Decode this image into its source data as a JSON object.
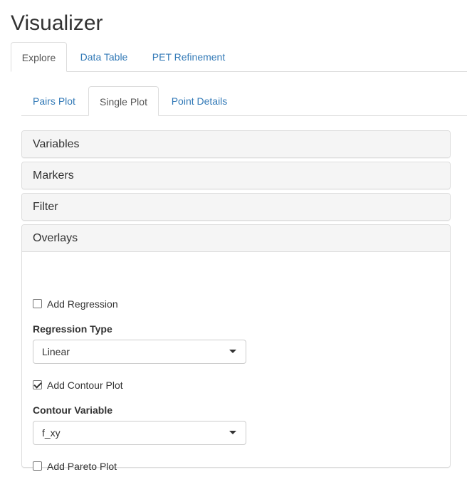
{
  "app": {
    "title": "Visualizer"
  },
  "top_tabs": [
    {
      "label": "Explore",
      "active": true
    },
    {
      "label": "Data Table",
      "active": false
    },
    {
      "label": "PET Refinement",
      "active": false
    }
  ],
  "sub_tabs": [
    {
      "label": "Pairs Plot",
      "active": false
    },
    {
      "label": "Single Plot",
      "active": true
    },
    {
      "label": "Point Details",
      "active": false
    }
  ],
  "panels": {
    "variables": {
      "title": "Variables",
      "expanded": false
    },
    "markers": {
      "title": "Markers",
      "expanded": false
    },
    "filter": {
      "title": "Filter",
      "expanded": false
    },
    "overlays": {
      "title": "Overlays",
      "expanded": true,
      "add_regression": {
        "label": "Add Regression",
        "checked": false
      },
      "regression_type": {
        "label": "Regression Type",
        "value": "Linear"
      },
      "add_contour": {
        "label": "Add Contour Plot",
        "checked": true
      },
      "contour_variable": {
        "label": "Contour Variable",
        "value": "f_xy"
      },
      "add_pareto": {
        "label": "Add Pareto Plot",
        "checked": false
      }
    }
  },
  "colors": {
    "link": "#337ab7",
    "panel_heading_bg": "#f5f5f5",
    "border": "#dddddd"
  },
  "icons": {
    "dropdown": "caret-down-icon",
    "checkbox_checked": "checkmark-icon"
  }
}
